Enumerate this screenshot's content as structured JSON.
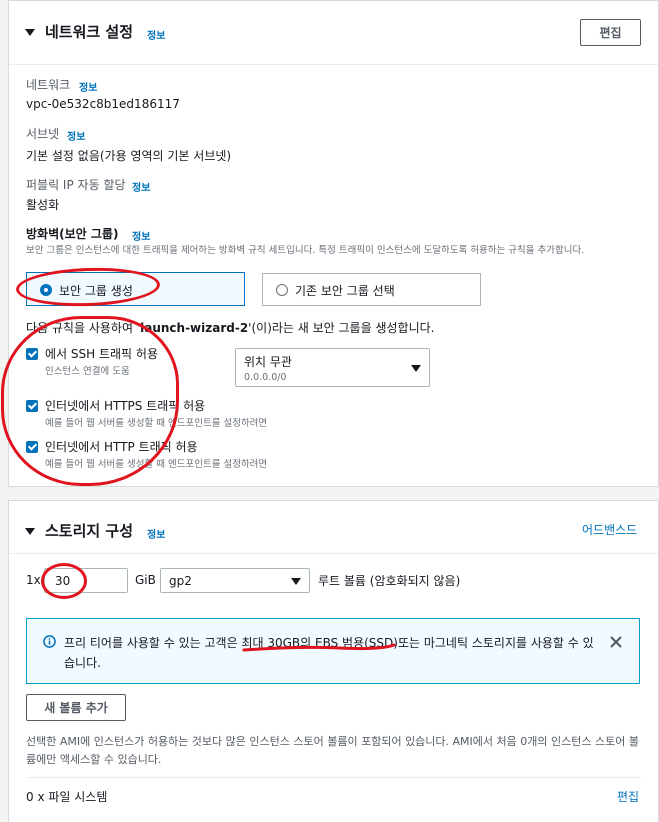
{
  "network": {
    "title": "네트워크 설정",
    "info": "정보",
    "edit_label": "편집",
    "network_label": "네트워크",
    "network_value": "vpc-0e532c8b1ed186117",
    "subnet_label": "서브넷",
    "subnet_value": "기본 설정 없음(가용 영역의 기본 서브넷)",
    "public_ip_label": "퍼블릭 IP 자동 할당",
    "public_ip_value": "활성화",
    "firewall_label": "방화벽(보안 그룹)",
    "firewall_desc": "보안 그룹은 인스턴스에 대한 트래픽을 제어하는 방화벽 규칙 세트입니다. 특정 트래픽이 인스턴스에 도달하도록 허용하는 규칙을 추가합니다.",
    "radio_create": "보안 그룹 생성",
    "radio_existing": "기존 보안 그룹 선택",
    "rule_intro_pre": "다음 규칙을 사용하여 '",
    "rule_intro_name": "launch-wizard-2",
    "rule_intro_post": "'(이)라는 새 보안 그룹을 생성합니다.",
    "rules": [
      {
        "label": "에서 SSH 트래픽 허용",
        "desc": "인스턴스 연결에 도움"
      },
      {
        "label": "인터넷에서 HTTPS 트래픽 허용",
        "desc": "예를 들어 웹 서버를 생성할 때 엔드포인트를 설정하려면"
      },
      {
        "label": "인터넷에서 HTTP 트래픽 허용",
        "desc": "예를 들어 웹 서버를 생성할 때 엔드포인트를 설정하려면"
      }
    ],
    "source_label": "위치 무관",
    "source_value": "0.0.0.0/0"
  },
  "storage": {
    "title": "스토리지 구성",
    "info": "정보",
    "advanced": "어드밴스드",
    "count_prefix": "1x",
    "size_value": "30",
    "size_unit": "GiB",
    "volume_type": "gp2",
    "root_volume": "루트 볼륨  (암호화되지 않음)",
    "alert_pre": "프리 티어를 사용할 수 있는 고객은 최대 30GB의 EBS 범용(SSD)",
    "alert_post": "또는 마그네틱 스토리지를 사용할 수 있습니다.",
    "add_volume": "새 볼륨 추가",
    "ami_note": "선택한 AMI에 인스턴스가 허용하는 것보다 많은 인스턴스 스토어 볼륨이 포함되어 있습니다. AMI에서 처음 0개의 인스턴스 스토어 볼륨에만 액세스할 수 있습니다.",
    "filesystems": "0 x 파일 시스템",
    "edit_label": "편집"
  },
  "colors": {
    "accent": "#0073bb",
    "annotation": "#e0141e"
  }
}
